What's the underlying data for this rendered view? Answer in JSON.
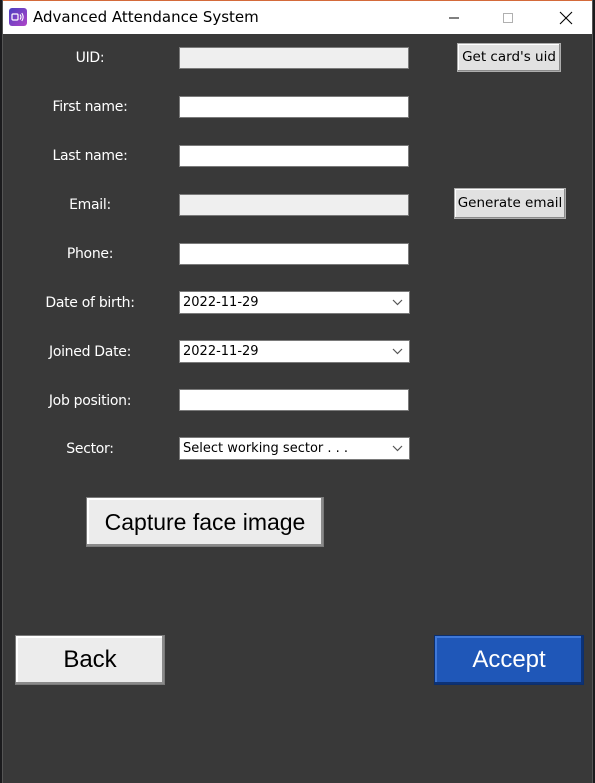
{
  "window": {
    "title": "Advanced Attendance System"
  },
  "form": {
    "uid_label": "UID:",
    "uid_value": "",
    "first_name_label": "First name:",
    "first_name_value": "",
    "last_name_label": "Last name:",
    "last_name_value": "",
    "email_label": "Email:",
    "email_value": "",
    "phone_label": "Phone:",
    "phone_value": "",
    "dob_label": "Date of birth:",
    "dob_value": "2022-11-29",
    "joined_label": "Joined Date:",
    "joined_value": "2022-11-29",
    "job_label": "Job position:",
    "job_value": "",
    "sector_label": "Sector:",
    "sector_value": "Select working sector . . ."
  },
  "buttons": {
    "get_uid": "Get card's uid",
    "generate_email": "Generate email",
    "capture_face": "Capture face image",
    "back": "Back",
    "accept": "Accept"
  },
  "colors": {
    "background": "#393939",
    "accept": "#1f57b8"
  },
  "icons": {
    "app": "attendance-app-icon",
    "minimize": "minimize-icon",
    "maximize": "maximize-icon",
    "close": "close-icon",
    "dropdown": "chevron-down-icon"
  }
}
